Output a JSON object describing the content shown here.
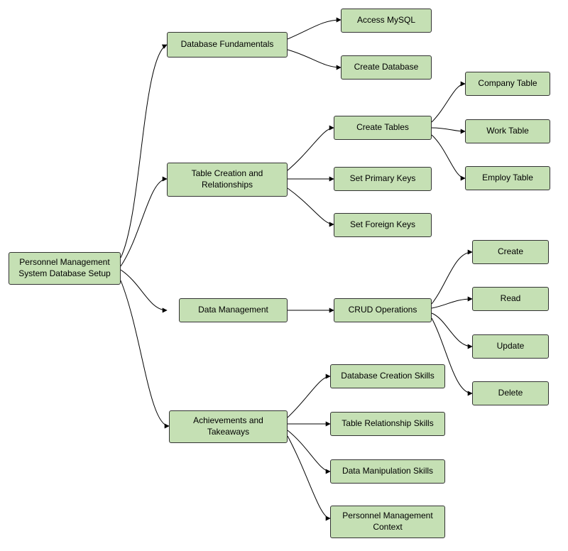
{
  "colors": {
    "node_fill": "#c5e0b4",
    "node_stroke": "#333333"
  },
  "root": {
    "label": "Personnel Management System Database Setup"
  },
  "level1": {
    "db_fundamentals": {
      "label": "Database Fundamentals"
    },
    "table_creation": {
      "label": "Table Creation and Relationships"
    },
    "data_management": {
      "label": "Data Management"
    },
    "achievements": {
      "label": "Achievements and Takeaways"
    }
  },
  "db_fundamentals_children": {
    "access_mysql": {
      "label": "Access MySQL"
    },
    "create_database": {
      "label": "Create Database"
    }
  },
  "table_creation_children": {
    "create_tables": {
      "label": "Create Tables"
    },
    "set_primary_keys": {
      "label": "Set Primary Keys"
    },
    "set_foreign_keys": {
      "label": "Set Foreign Keys"
    }
  },
  "create_tables_children": {
    "company_table": {
      "label": "Company Table"
    },
    "work_table": {
      "label": "Work Table"
    },
    "employ_table": {
      "label": "Employ Table"
    }
  },
  "data_management_children": {
    "crud_operations": {
      "label": "CRUD Operations"
    }
  },
  "crud_children": {
    "create": {
      "label": "Create"
    },
    "read": {
      "label": "Read"
    },
    "update": {
      "label": "Update"
    },
    "delete": {
      "label": "Delete"
    }
  },
  "achievements_children": {
    "db_creation_skills": {
      "label": "Database Creation Skills"
    },
    "table_relationship_skills": {
      "label": "Table Relationship Skills"
    },
    "data_manipulation_skills": {
      "label": "Data Manipulation Skills"
    },
    "personnel_mgmt_context": {
      "label": "Personnel Management Context"
    }
  }
}
